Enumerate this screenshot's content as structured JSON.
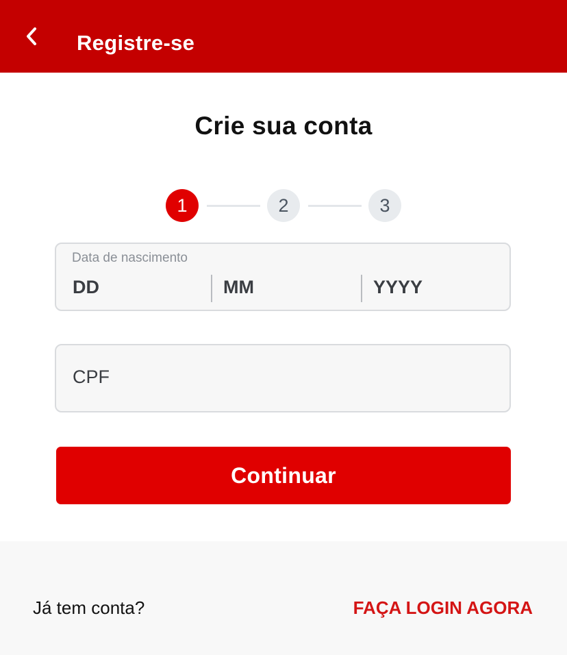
{
  "header": {
    "title": "Registre-se",
    "back_icon": "chevron-left-icon",
    "background_color": "#c40000"
  },
  "page": {
    "title": "Crie sua conta"
  },
  "stepper": {
    "steps": [
      "1",
      "2",
      "3"
    ],
    "current": 1,
    "active_color": "#e00000",
    "inactive_color": "#e8ebee"
  },
  "form": {
    "birth_date": {
      "label": "Data de nascimento",
      "day_placeholder": "DD",
      "month_placeholder": "MM",
      "year_placeholder": "YYYY"
    },
    "cpf": {
      "placeholder": "CPF"
    },
    "continue_label": "Continuar",
    "button_color": "#e00000"
  },
  "footer": {
    "question": "Já tem conta?",
    "login_link": "FAÇA LOGIN AGORA",
    "link_color": "#d41515"
  }
}
